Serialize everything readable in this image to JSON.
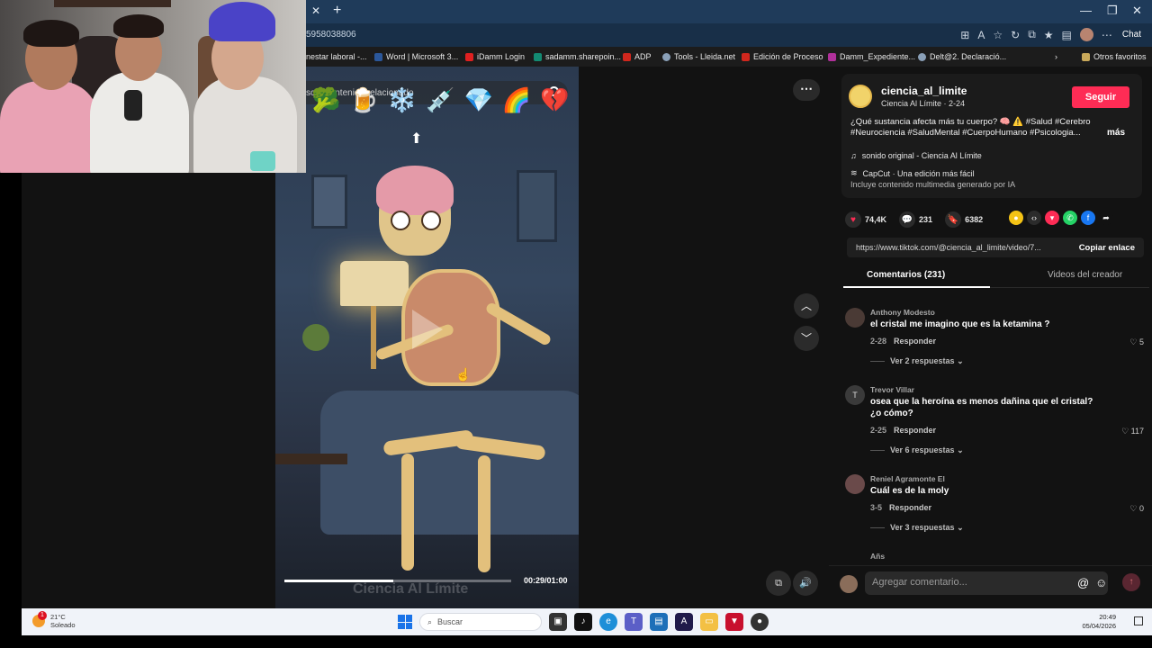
{
  "browser": {
    "url_fragment": "5958038806",
    "bookmarks": [
      {
        "label": "nestar laboral -...",
        "color": "#e8e8e8"
      },
      {
        "label": "Word | Microsoft 3...",
        "color": "#2b579a"
      },
      {
        "label": "iDamm Login",
        "color": "#e02020"
      },
      {
        "label": "sadamm.sharepoin...",
        "color": "#138a72"
      },
      {
        "label": "ADP",
        "color": "#d0271d"
      },
      {
        "label": "Tools - Lleida.net",
        "color": "#8aa0b8"
      },
      {
        "label": "Edición de Proceso",
        "color": "#d0271d"
      },
      {
        "label": "Damm_Expediente...",
        "color": "#b0309a"
      },
      {
        "label": "Delt@2. Declaració...",
        "color": "#8aa0b8"
      }
    ],
    "other_favorites": "Otros favoritos",
    "chat_label": "Chat"
  },
  "player": {
    "search_placeholder": "scar contenido relacionado",
    "emojis": [
      "🥦",
      "🍺",
      "❄️",
      "💉",
      "💎",
      "🌈",
      "💔"
    ],
    "watermark": "Ciencia Al Límite",
    "time": "00:29/01:00",
    "progress": 0.48
  },
  "post": {
    "channel_name": "ciencia_al_limite",
    "channel_sub": "Ciencia Al Límite · 2-24",
    "follow_label": "Seguir",
    "description": "¿Qué sustancia afecta más tu cuerpo? 🧠 ⚠️ #Salud #Cerebro #Neurociencia #SaludMental #CuerpoHumano #Psicologia...",
    "more_label": "más",
    "sound": "sonido original - Ciencia Al Límite",
    "capcut": "CapCut · Una edición más fácil",
    "ai_note": "Incluye contenido multimedia generado por IA",
    "likes": "74,4K",
    "comments_count": "231",
    "saves": "6382",
    "link": "https://www.tiktok.com/@ciencia_al_limite/video/7...",
    "copy_label": "Copiar enlace"
  },
  "tabs": {
    "comments": "Comentarios (231)",
    "creator_videos": "Videos del creador"
  },
  "comments": [
    {
      "user": "Anthony Modesto",
      "initial": "",
      "text": "el cristal me imagino que es la ketamina ?",
      "date": "2-28",
      "reply": "Responder",
      "likes": "5",
      "replies": "Ver 2 respuestas"
    },
    {
      "user": "Trevor Villar",
      "initial": "T",
      "text": "osea que la heroína es menos dañina que el cristal? ¿o cómo?",
      "date": "2-25",
      "reply": "Responder",
      "likes": "117",
      "replies": "Ver 6 respuestas"
    },
    {
      "user": "Reniel Agramonte El",
      "initial": "",
      "text": "Cuál es de la moly",
      "date": "3-5",
      "reply": "Responder",
      "likes": "0",
      "replies": "Ver 3 respuestas"
    },
    {
      "user": "Añs",
      "initial": "",
      "text": "",
      "date": "",
      "reply": "",
      "likes": "",
      "replies": ""
    }
  ],
  "comment_bar": {
    "placeholder": "Agregar comentario..."
  },
  "taskbar": {
    "temp": "21°C",
    "weather": "Soleado",
    "search": "Buscar",
    "time": "20:49",
    "date": "05/04/2026",
    "badge": "1"
  }
}
